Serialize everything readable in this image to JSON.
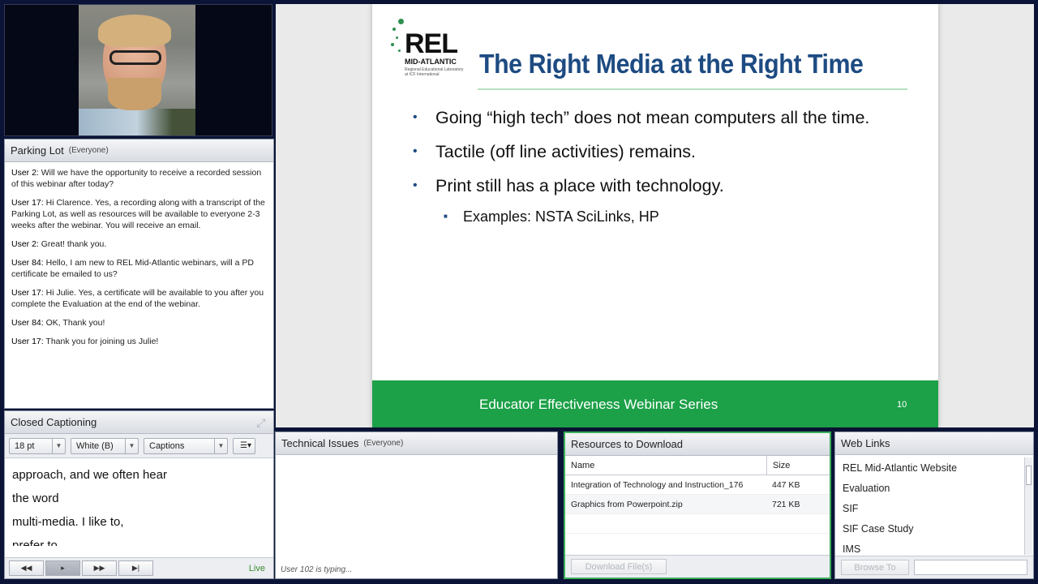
{
  "camera": {
    "icon": "webcam-presenter"
  },
  "parking_lot": {
    "title": "Parking Lot",
    "audience": "(Everyone)",
    "messages": [
      {
        "user": "User 2:",
        "text": "Will we have the opportunity to receive a recorded session of this webinar after today?"
      },
      {
        "user": "User 17:",
        "text": "Hi Clarence. Yes, a recording along with a transcript of the Parking Lot, as well as resources will be available to everyone 2-3 weeks after the webinar. You will receive an email."
      },
      {
        "user": "User 2:",
        "text": "Great! thank you."
      },
      {
        "user": "User 84:",
        "text": "Hello, I am new to REL Mid-Atlantic webinars, will a PD certificate be emailed to us?"
      },
      {
        "user": "User 17:",
        "text": "Hi Julie. Yes, a certificate will be available to you after you complete the Evaluation at the end of the webinar."
      },
      {
        "user": "User 84:",
        "text": "OK, Thank you!"
      },
      {
        "user": "User 17:",
        "text": "Thank you for joining us Julie!"
      }
    ]
  },
  "closed_captioning": {
    "title": "Closed Captioning",
    "font_size": "18 pt",
    "color": "White (B)",
    "mode": "Captions",
    "lines": [
      "approach, and we often hear",
      "the word",
      "multi-media.  I like to,",
      "prefer to"
    ],
    "live_label": "Live"
  },
  "slide": {
    "logo": {
      "main": "REL",
      "sub": "MID-ATLANTIC",
      "tagline": "Regional Educational Laboratory at ICF International"
    },
    "title": "The Right Media at the Right Time",
    "bullets": [
      "Going “high tech” does not mean computers all the time.",
      "Tactile (off line activities) remains.",
      "Print still has a place with technology."
    ],
    "sub_bullet": "Examples: NSTA SciLinks, HP",
    "footer": "Educator Effectiveness Webinar Series",
    "page": "10",
    "brand_color": "#1ca048",
    "title_color": "#1d4b82"
  },
  "technical_issues": {
    "title": "Technical Issues",
    "audience": "(Everyone)",
    "status": "User 102 is typing..."
  },
  "resources": {
    "title": "Resources to Download",
    "columns": {
      "name": "Name",
      "size": "Size"
    },
    "files": [
      {
        "name": "Integration of Technology and Instruction_176",
        "size": "447 KB"
      },
      {
        "name": "Graphics from Powerpoint.zip",
        "size": "721 KB"
      }
    ],
    "download_button": "Download File(s)"
  },
  "web_links": {
    "title": "Web Links",
    "links": [
      "REL Mid-Atlantic Website",
      "Evaluation",
      "SIF",
      "SIF Case Study",
      "IMS"
    ],
    "browse_button": "Browse To"
  }
}
